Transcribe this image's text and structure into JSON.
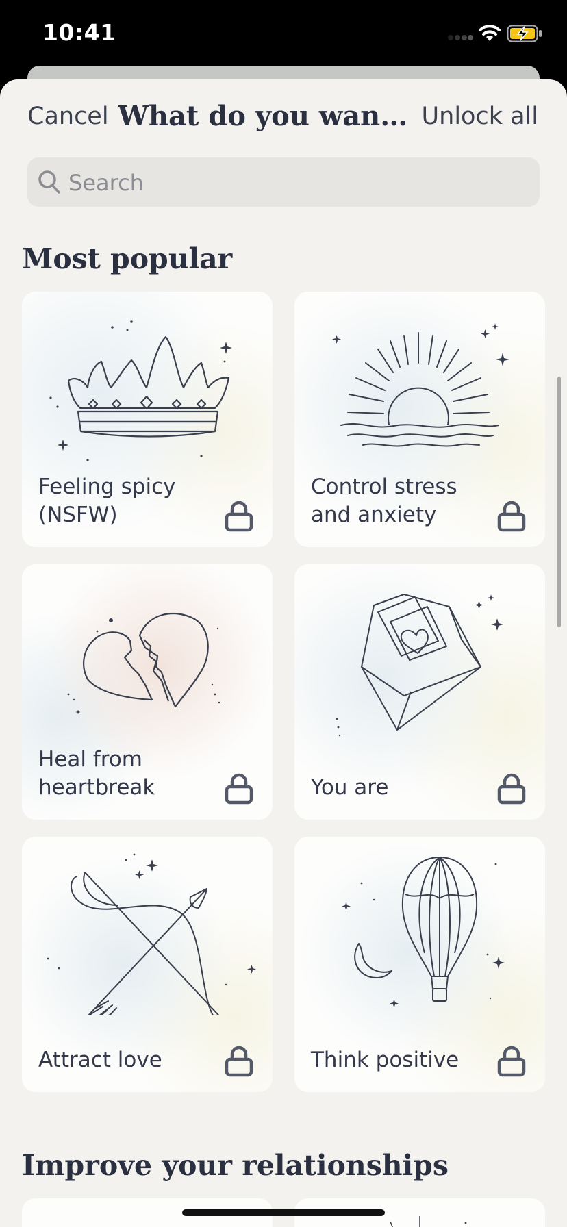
{
  "status_bar": {
    "time": "10:41"
  },
  "nav": {
    "cancel_label": "Cancel",
    "title": "What do you want to focus on?",
    "unlock_label": "Unlock all"
  },
  "search": {
    "placeholder": "Search"
  },
  "sections": [
    {
      "title": "Most popular",
      "cards": [
        {
          "label": "Feeling spicy (NSFW)",
          "icon": "crown-icon",
          "locked": true
        },
        {
          "label": "Control stress and anxiety",
          "icon": "sunrise-icon",
          "locked": true
        },
        {
          "label": "Heal from heartbreak",
          "icon": "broken-heart-icon",
          "locked": true
        },
        {
          "label": "You are",
          "icon": "love-letter-icon",
          "locked": true
        },
        {
          "label": "Attract love",
          "icon": "bow-arrow-icon",
          "locked": true
        },
        {
          "label": "Think positive",
          "icon": "hot-air-balloon-icon",
          "locked": true
        }
      ]
    },
    {
      "title": "Improve your relationships"
    }
  ],
  "colors": {
    "background": "#f3f2ef",
    "card": "#fdfdfc",
    "text": "#33384a",
    "lock": "#54596a"
  }
}
